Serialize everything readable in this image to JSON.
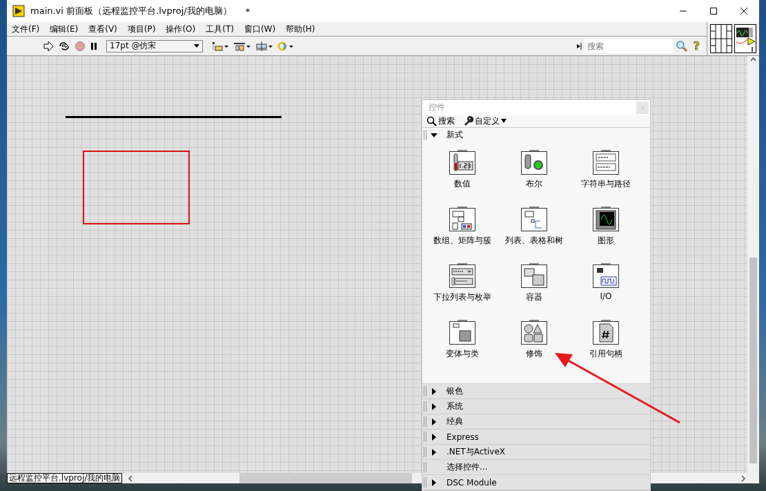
{
  "window": {
    "title": "main.vi 前面板（远程监控平台.lvproj/我的电脑）",
    "modified_mark": "*"
  },
  "menu": [
    "文件(F)",
    "编辑(E)",
    "查看(V)",
    "项目(P)",
    "操作(O)",
    "工具(T)",
    "窗口(W)",
    "帮助(H)"
  ],
  "toolbar": {
    "font": "17pt @仿宋",
    "search": {
      "placeholder": "搜索"
    },
    "help": "?"
  },
  "palette": {
    "title": "控件",
    "tools": [
      "搜索",
      "自定义"
    ],
    "categories": [
      {
        "kind": "category",
        "label": "新式",
        "expanded": true,
        "items": [
          "数值",
          "布尔",
          "字符串与路径",
          "数组、矩阵与簇",
          "列表、表格和树",
          "图形",
          "下拉列表与枚举",
          "容器",
          "I/O",
          "变体与类",
          "修饰",
          "引用句柄"
        ]
      },
      {
        "kind": "category",
        "label": "银色",
        "expanded": false
      },
      {
        "kind": "category",
        "label": "系统",
        "expanded": false
      },
      {
        "kind": "category",
        "label": "经典",
        "expanded": false
      },
      {
        "kind": "category",
        "label": "Express",
        "expanded": false
      },
      {
        "kind": "category",
        "label": ".NET与ActiveX",
        "expanded": false
      },
      {
        "kind": "action",
        "label": "选择控件..."
      },
      {
        "kind": "category",
        "label": "DSC Module",
        "expanded": false
      }
    ]
  },
  "status": {
    "context": "远程监控平台.lvproj/我的电脑"
  }
}
